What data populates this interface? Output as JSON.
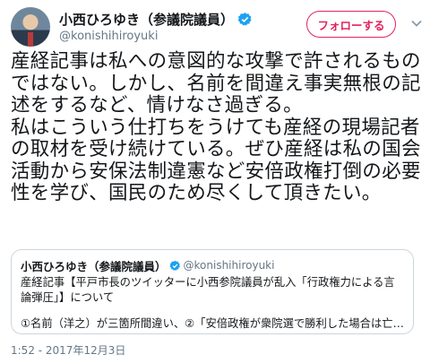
{
  "author": {
    "name": "小西ひろゆき（参議院議員）",
    "handle": "@konishihiroyuki",
    "verified": true,
    "avatar_icon": "profile-photo"
  },
  "follow_button": {
    "label": "フォローする",
    "color": "#e0245e"
  },
  "menu_icon": "chevron-down-icon",
  "tweet": {
    "text": "産経記事は私への意図的な攻撃で許されるものではない。しかし、名前を間違え事実無根の記述をするなど、情けなさ過ぎる。\n私はこういう仕打ちをうけても産経の現場記者の取材を受け続けている。ぜひ産経は私の国会活動から安保法制違憲など安倍政権打倒の必要性を学び、国民のため尽くして頂きたい。"
  },
  "quoted_tweet": {
    "name": "小西ひろゆき（参議院議員）",
    "handle": "@konishihiroyuki",
    "verified": true,
    "body": "産経記事【平戸市長のツイッターに小西参院議員が乱入「行政権力による言論弾圧」】について",
    "tail": "①名前（洋之）が三箇所間違い、②「安倍政権が衆院選で勝利した場合は亡命す…"
  },
  "timestamp": "1:52 - 2017年12月3日",
  "colors": {
    "text": "#14171a",
    "secondary": "#657786",
    "verified": "#1da1f2",
    "border": "#ccd6dd"
  }
}
